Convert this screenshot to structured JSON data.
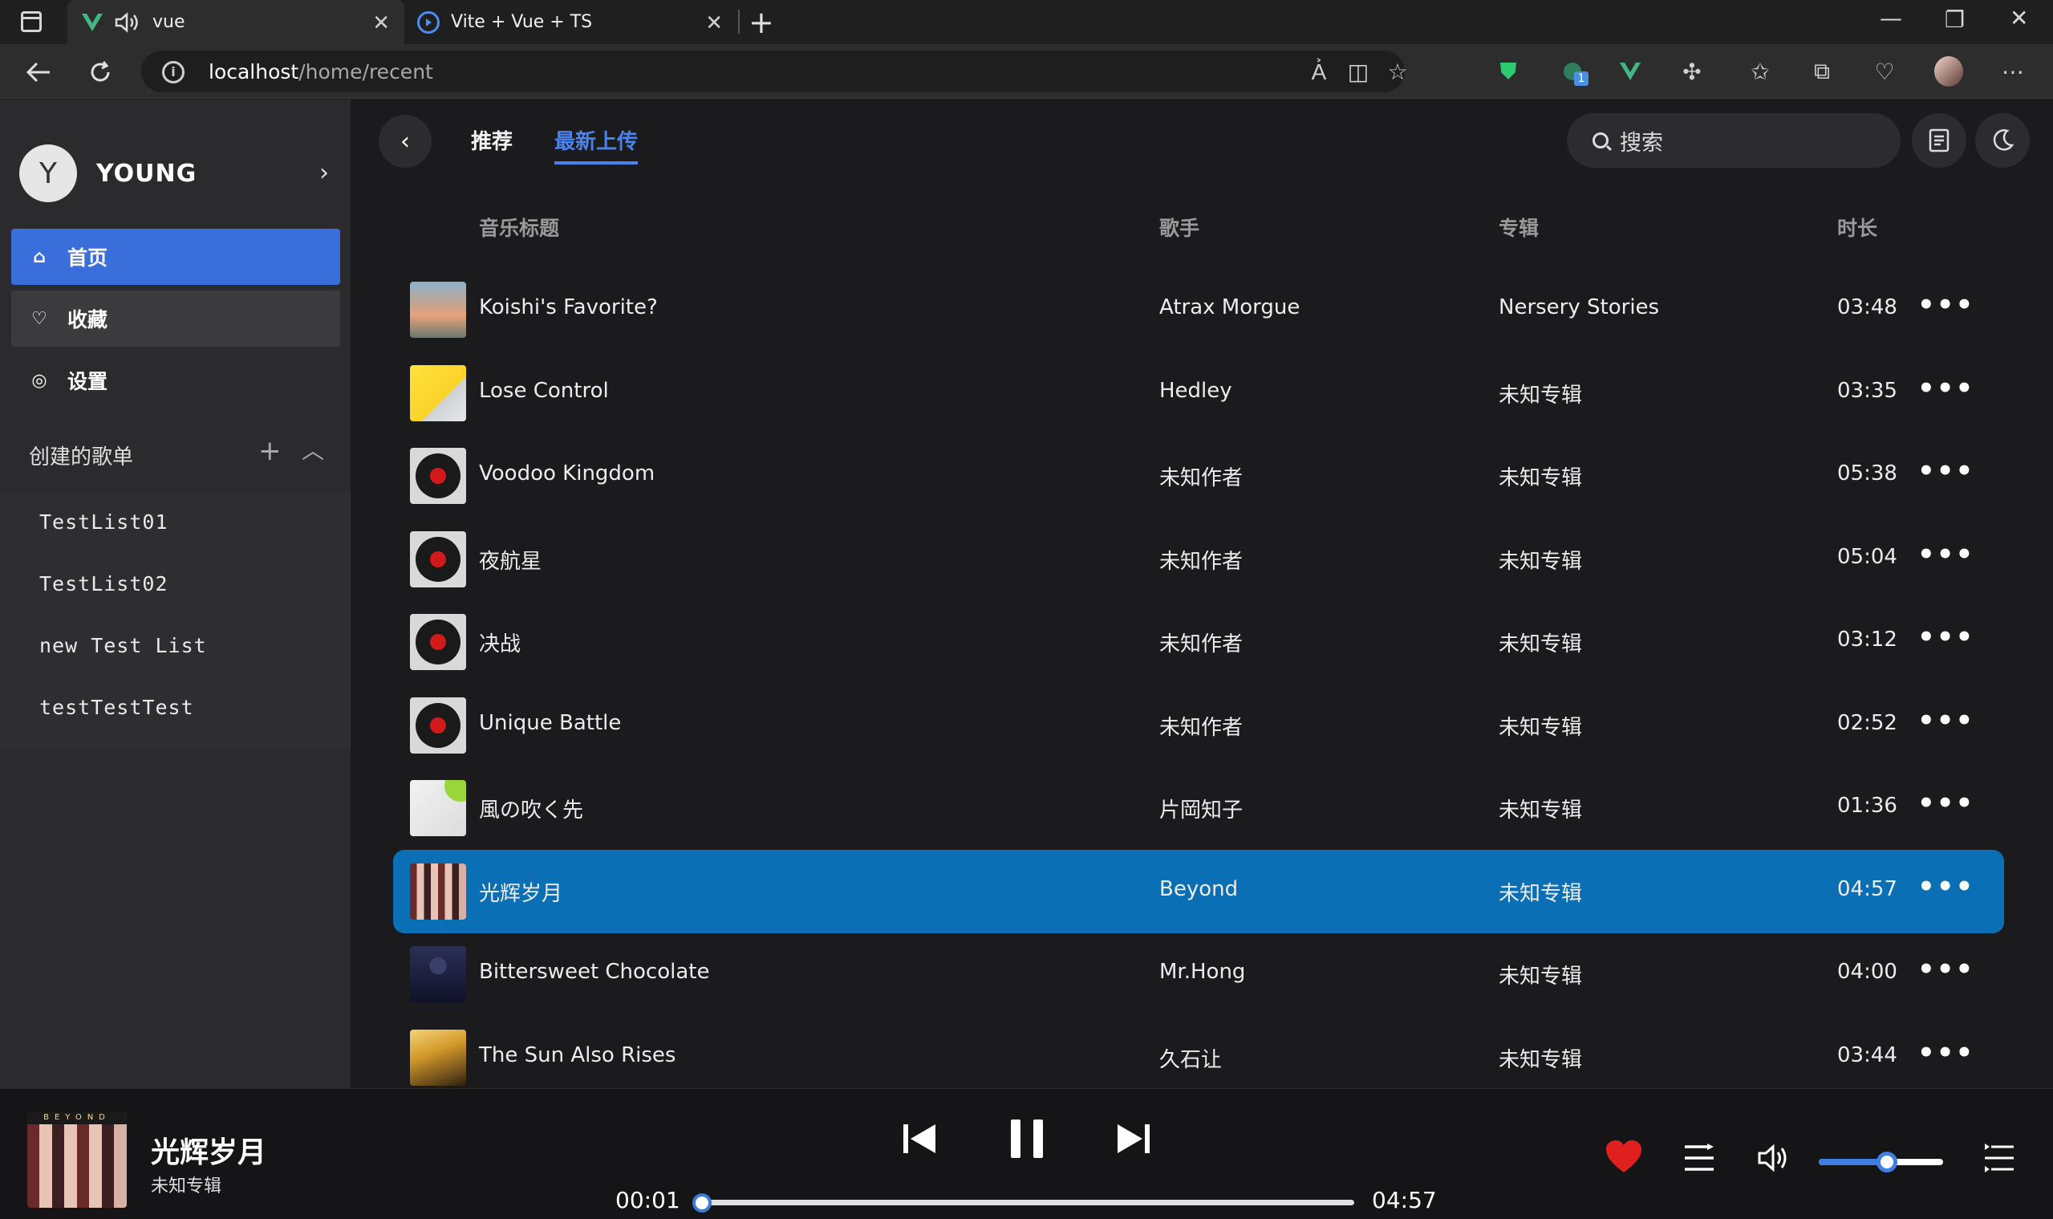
{
  "browser": {
    "tabs": [
      {
        "title": "vue",
        "active": true
      },
      {
        "title": "Vite + Vue + TS",
        "active": false
      }
    ],
    "url_host": "localhost",
    "url_path": "/home/recent",
    "extension_badge": "1"
  },
  "sidebar": {
    "avatar_letter": "Y",
    "username": "YOUNG",
    "menu": [
      {
        "label": "首页",
        "icon": "home-icon",
        "active": true
      },
      {
        "label": "收藏",
        "icon": "heart-icon",
        "active": false
      },
      {
        "label": "设置",
        "icon": "settings-icon",
        "active": false
      }
    ],
    "playlists_heading": "创建的歌单",
    "playlists": [
      "TestList01",
      "TestList02",
      "new Test List",
      "testTestTest"
    ]
  },
  "header": {
    "tabs": [
      "推荐",
      "最新上传"
    ],
    "active_tab": "最新上传",
    "search_placeholder": "搜索"
  },
  "table": {
    "columns": [
      "音乐标题",
      "歌手",
      "专辑",
      "时长"
    ],
    "rows": [
      {
        "title": "Koishi's Favorite?",
        "artist": "Atrax Morgue",
        "album": "Nersery Stories",
        "duration": "03:48",
        "cover": "sky"
      },
      {
        "title": "Lose Control",
        "artist": "Hedley",
        "album": "未知专辑",
        "duration": "03:35",
        "cover": "yellow"
      },
      {
        "title": "Voodoo Kingdom",
        "artist": "未知作者",
        "album": "未知专辑",
        "duration": "05:38",
        "cover": "vinyl"
      },
      {
        "title": "夜航星",
        "artist": "未知作者",
        "album": "未知专辑",
        "duration": "05:04",
        "cover": "vinyl"
      },
      {
        "title": "决战",
        "artist": "未知作者",
        "album": "未知专辑",
        "duration": "03:12",
        "cover": "vinyl"
      },
      {
        "title": "Unique Battle",
        "artist": "未知作者",
        "album": "未知专辑",
        "duration": "02:52",
        "cover": "vinyl"
      },
      {
        "title": "風の吹く先",
        "artist": "片岡知子",
        "album": "未知专辑",
        "duration": "01:36",
        "cover": "lime"
      },
      {
        "title": "光辉岁月",
        "artist": "Beyond",
        "album": "未知专辑",
        "duration": "04:57",
        "cover": "beyond",
        "playing": true
      },
      {
        "title": "Bittersweet Chocolate",
        "artist": "Mr.Hong",
        "album": "未知专辑",
        "duration": "04:00",
        "cover": "night"
      },
      {
        "title": "The Sun Also Rises",
        "artist": "久石让",
        "album": "未知专辑",
        "duration": "03:44",
        "cover": "sunset"
      }
    ]
  },
  "player": {
    "title": "光辉岁月",
    "album": "未知专辑",
    "elapsed": "00:01",
    "total": "04:57",
    "progress_fraction": 0.003,
    "volume_fraction": 0.55,
    "liked": true,
    "cover_text": "BEYOND",
    "colors": {
      "accent": "#3a6fdb",
      "playing_row": "#0a6fb5",
      "like": "#e0201f"
    }
  }
}
